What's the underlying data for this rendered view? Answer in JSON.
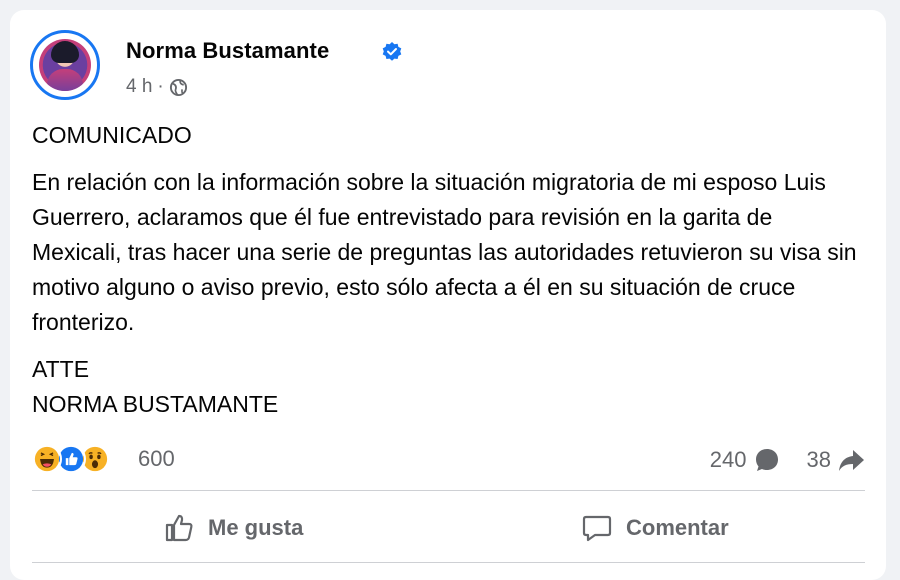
{
  "post": {
    "author": "Norma Bustamante",
    "time": "4 h",
    "separator": "·",
    "paragraphs": [
      "COMUNICADO",
      "En relación con la información sobre la situación migratoria de mi esposo Luis Guerrero, aclaramos que él fue entrevistado para revisión en la garita de Mexicali, tras hacer una serie de preguntas las autoridades retuvieron su visa sin motivo alguno o aviso previo, esto sólo afecta a él en su situación de cruce fronterizo.",
      "ATTE\nNORMA BUSTAMANTE"
    ]
  },
  "stats": {
    "reactions": "600",
    "comments": "240",
    "shares": "38",
    "reaction_icons": [
      "haha-icon",
      "like-icon",
      "wow-icon"
    ]
  },
  "actions": {
    "like_label": "Me gusta",
    "comment_label": "Comentar"
  },
  "colors": {
    "brand_blue": "#1877f2",
    "muted_text": "#65676b",
    "reaction_yellow": "#f7b125"
  }
}
